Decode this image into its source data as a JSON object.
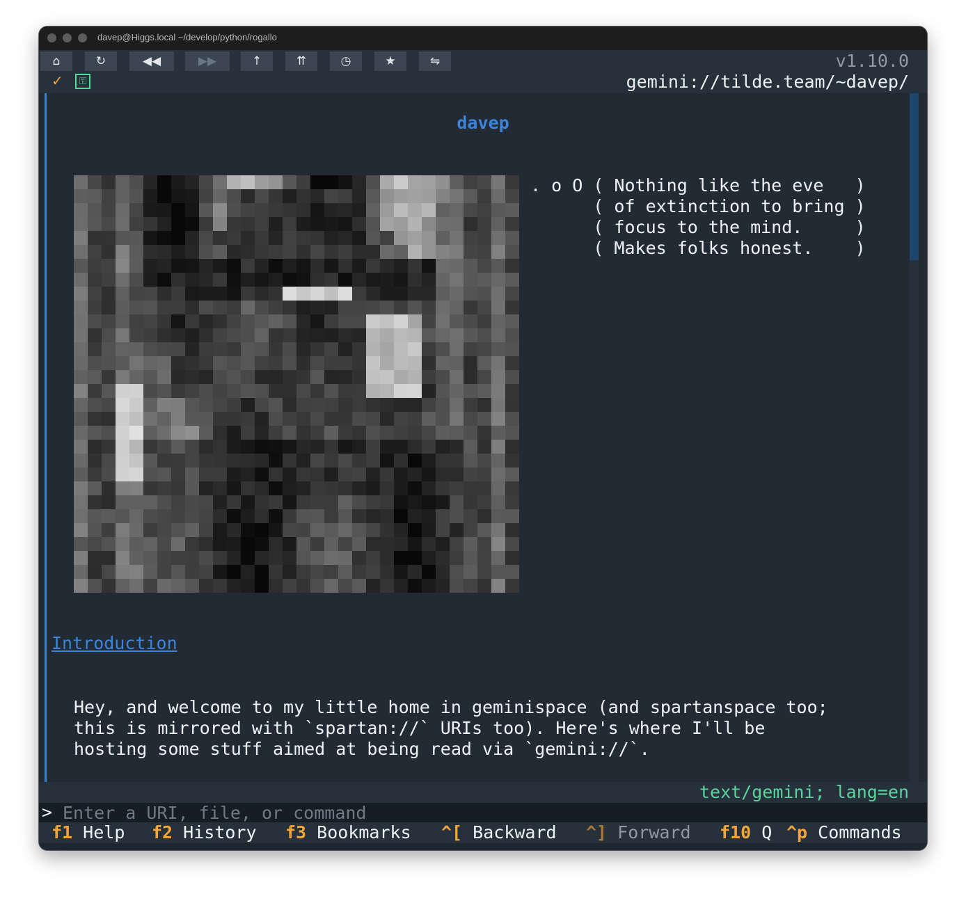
{
  "window": {
    "title": "davep@Higgs.local ~/develop/python/rogallo"
  },
  "toolbar": {
    "buttons": [
      {
        "icon": "home-icon",
        "glyph": "⌂",
        "enabled": true
      },
      {
        "icon": "reload-icon",
        "glyph": "↻",
        "enabled": true
      },
      {
        "icon": "back-icon",
        "glyph": "◀◀",
        "enabled": true
      },
      {
        "icon": "forward-icon",
        "glyph": "▶▶",
        "enabled": false
      },
      {
        "icon": "up-icon",
        "glyph": "↑",
        "enabled": true
      },
      {
        "icon": "root-icon",
        "glyph": "⇈",
        "enabled": true
      },
      {
        "icon": "history-icon",
        "glyph": "◷",
        "enabled": true
      },
      {
        "icon": "bookmark-icon",
        "glyph": "★",
        "enabled": true
      },
      {
        "icon": "swap-icon",
        "glyph": "⇋",
        "enabled": true
      }
    ],
    "version": "v1.10.0",
    "status_check_glyph": "✓",
    "key_glyph": "⚿",
    "address": "gemini://tilde.team/~davep/"
  },
  "page": {
    "heading": "davep",
    "quote": ". o O ( Nothing like the eve   )\n      ( of extinction to bring )\n      ( focus to the mind.     )\n      ( Makes folks honest.    )",
    "intro_link": "Introduction",
    "paragraph": "Hey, and welcome to my little home in geminispace (and spartanspace too;\nthis is mirrored with `spartan://` URIs too). Here's where I'll be\nhosting some stuff aimed at being read via `gemini://`."
  },
  "status": {
    "mime": "text/gemini; lang=en"
  },
  "command": {
    "prompt": ">",
    "placeholder": "Enter a URI, file, or command",
    "value": ""
  },
  "footer": {
    "keys": [
      {
        "key": "f1",
        "label": "Help"
      },
      {
        "key": "f2",
        "label": "History"
      },
      {
        "key": "f3",
        "label": "Bookmarks"
      },
      {
        "key": "^[",
        "label": "Backward"
      },
      {
        "key": "^]",
        "label": "Forward"
      },
      {
        "key": "f10",
        "label": "Q"
      },
      {
        "key": "^p",
        "label": "Commands"
      }
    ]
  },
  "colors": {
    "accent": "#3b84d9",
    "link": "#3b84d9",
    "key_orange": "#f3a53b",
    "mime_green": "#59d49b",
    "background": "#222a33"
  }
}
